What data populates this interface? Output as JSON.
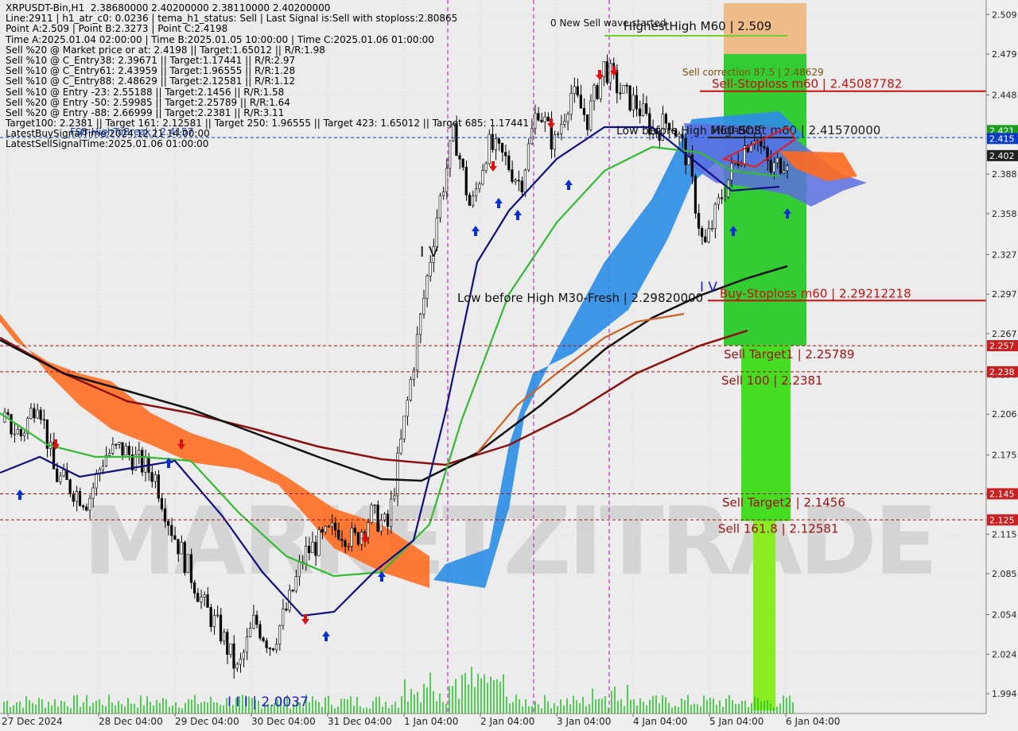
{
  "info_lines": [
    "XRPUSDT-Bin,H1  2.38680000 2.40200000 2.38110000 2.40200000",
    "Line:2911 | h1_atr_c0: 0.0236 | tema_h1_status: Sell | Last Signal is:Sell with stoploss:2.80865",
    "Point A:2.509 | Point B:2.3273 | Point C:2.4198",
    "Time A:2025.01.04 02:00:00 | Time B:2025.01.05 10:00:00 | Time C:2025.01.06 01:00:00",
    "Sell %20 @ Market price or at: 2.4198 || Target:1.65012 || R/R:1.98",
    "Sell %10 @ C_Entry38: 2.39671 || Target:1.17441 || R/R:2.97",
    "Sell %10 @ C_Entry61: 2.43959 || Target:1.96555 || R/R:1.28",
    "Sell %10 @ C_Entry88: 2.48629 || Target:2.12581 || R/R:1.12",
    "Sell %10 @ Entry -23: 2.55188 || Target:2.1456 || R/R:1.58",
    "Sell %20 @ Entry -50: 2.59985 || Target:2.25789 || R/R:1.64",
    "Sell %20 @ Entry -88: 2.66999 || Target:2.2381 || R/R:3.11",
    "Target100: 2.2381 || Target 161: 2.12581 || Target 250: 1.96555 || Target 423: 1.65012 || Target 685: 1.17441",
    "LatestBuySignalTime:2024.12.21 14:00:00",
    "LatestSellSignalTime:2025.01.06 01:00:00"
  ],
  "watermark": "MARKETZITRADE",
  "chart_data": {
    "type": "candlestick",
    "symbol": "XRPUSDT-Bin",
    "timeframe": "H1",
    "ohlc_last": {
      "open": 2.3868,
      "high": 2.402,
      "low": 2.3811,
      "close": 2.402
    },
    "ylim": [
      1.979,
      2.52
    ],
    "y_ticks": [
      1.994,
      2.024,
      2.054,
      2.085,
      2.115,
      2.145,
      2.175,
      2.206,
      2.236,
      2.267,
      2.297,
      2.327,
      2.358,
      2.388,
      2.418,
      2.448,
      2.479,
      2.509
    ],
    "x_labels": [
      "27 Dec 2024",
      "28 Dec 04:00",
      "29 Dec 04:00",
      "30 Dec 04:00",
      "31 Dec 04:00",
      "1 Jan 04:00",
      "2 Jan 04:00",
      "3 Jan 04:00",
      "4 Jan 04:00",
      "5 Jan 04:00",
      "6 Jan 04:00"
    ],
    "close_path": [
      2.2,
      2.19,
      2.22,
      2.16,
      2.15,
      2.14,
      2.175,
      2.18,
      2.17,
      2.16,
      2.12,
      2.09,
      2.06,
      2.04,
      2.01,
      2.05,
      2.03,
      2.06,
      2.1,
      2.11,
      2.12,
      2.11,
      2.13,
      2.12,
      2.2,
      2.28,
      2.36,
      2.42,
      2.36,
      2.41,
      2.4,
      2.38,
      2.44,
      2.41,
      2.45,
      2.43,
      2.47,
      2.45,
      2.44,
      2.42,
      2.43,
      2.4,
      2.33,
      2.37,
      2.4,
      2.42,
      2.39,
      2.402
    ],
    "price_labels": [
      {
        "value": 2.421,
        "text": "2.421",
        "color": "#1e9e1e"
      },
      {
        "value": 2.415,
        "text": "2.415",
        "color": "#0a3cc8"
      },
      {
        "value": 2.402,
        "text": "2.402",
        "color": "#202020"
      },
      {
        "value": 2.2579,
        "text": "2.257",
        "color": "#c82020"
      },
      {
        "value": 2.2381,
        "text": "2.238",
        "color": "#c82020"
      },
      {
        "value": 2.1456,
        "text": "2.145",
        "color": "#c82020"
      },
      {
        "value": 2.1258,
        "text": "2.125",
        "color": "#c82020"
      }
    ],
    "levels": [
      {
        "value": 2.4157,
        "text": "FSB-HighToBreak | 2.4157",
        "color": "#0a3cc8",
        "dash": true
      },
      {
        "value": 2.45087782,
        "text": "Sell-Stoploss m60 | 2.45087782",
        "color": "#c81010",
        "dash": false
      },
      {
        "value": 2.4157,
        "text": "HighShift m60 | 2.41570000",
        "color": "#202020",
        "dash": false
      },
      {
        "value": 2.29212218,
        "text": "Buy-Stoploss m60 | 2.29212218",
        "color": "#c81010",
        "dash": false
      },
      {
        "value": 2.25789,
        "text": "Sell Target1 | 2.25789",
        "color": "#a01010",
        "dash": true
      },
      {
        "value": 2.2381,
        "text": "Sell 100 | 2.2381",
        "color": "#a01010",
        "dash": true
      },
      {
        "value": 2.1456,
        "text": "Sell Target2 | 2.1456",
        "color": "#a01010",
        "dash": true
      },
      {
        "value": 2.12581,
        "text": "Sell 161.8 | 2.12581",
        "color": "#a01010",
        "dash": true
      }
    ],
    "annotations": [
      {
        "text": "0 New Sell wave started"
      },
      {
        "text": "HighestHigh   M60 | 2.509"
      },
      {
        "text": "Sell correction 87.5 | 2.48629"
      },
      {
        "text": "Low before High   M60-BOS"
      },
      {
        "text": "Low before High   M30-Fresh | 2.29820000"
      },
      {
        "text": "I V"
      },
      {
        "text": "I V"
      },
      {
        "text": "I I I | 2.0037"
      }
    ]
  }
}
